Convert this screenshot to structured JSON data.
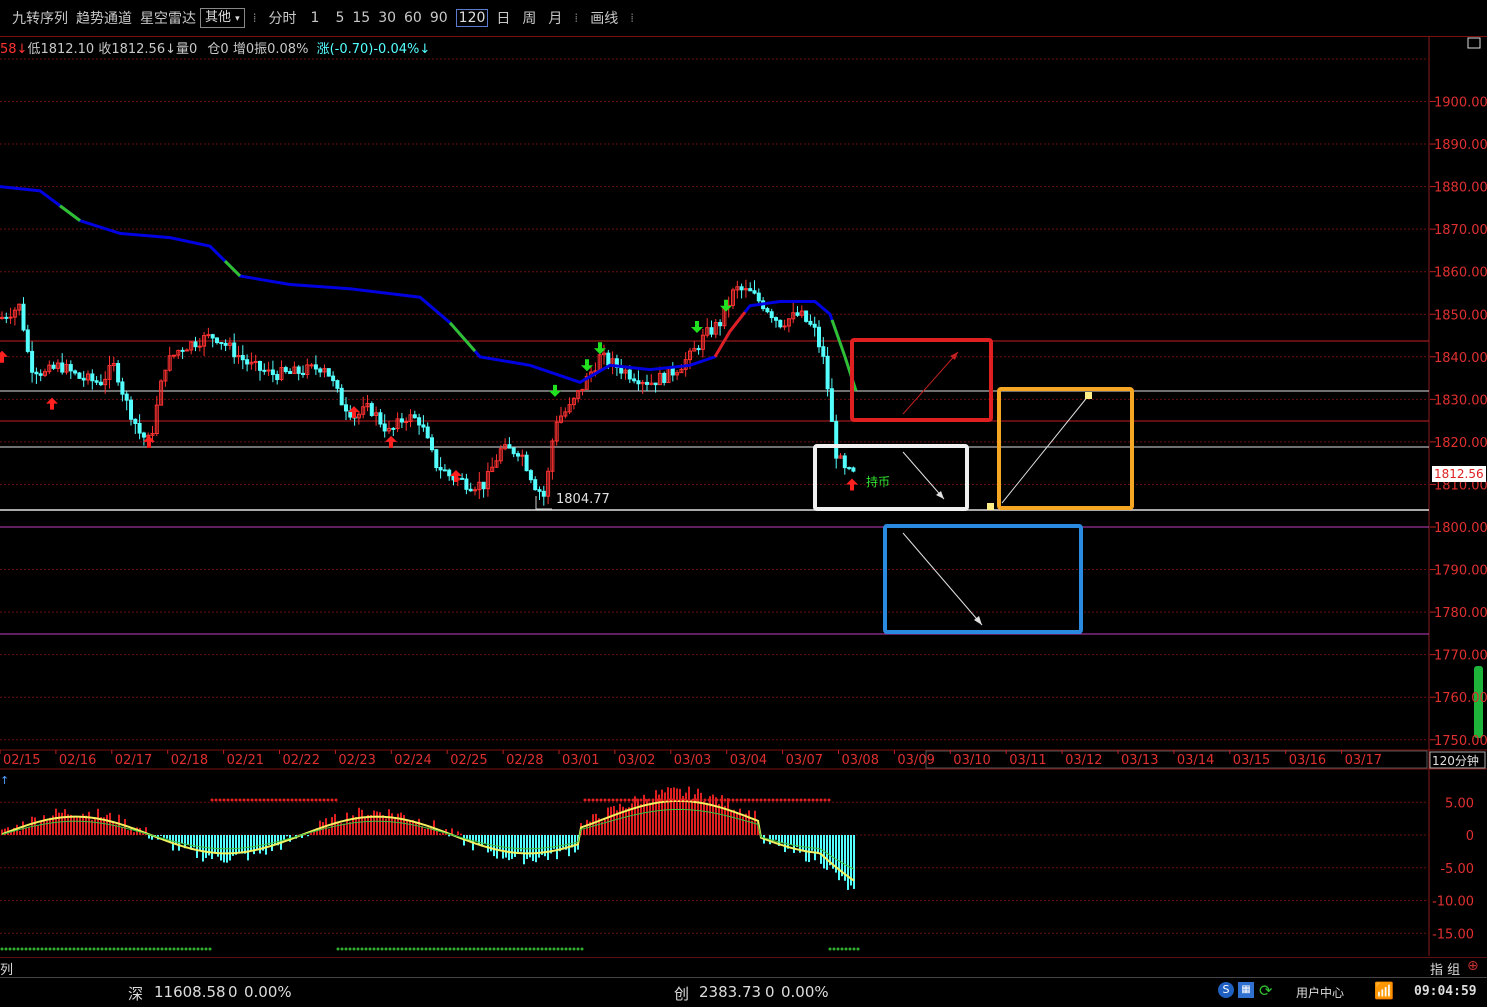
{
  "toolbar": {
    "items": [
      "九转序列",
      "趋势通道",
      "星空雷达"
    ],
    "select_label": "其他",
    "periods": [
      "分时",
      "1",
      "5",
      "15",
      "30",
      "60",
      "90",
      "120",
      "日",
      "周",
      "月"
    ],
    "active_period": "120",
    "draw_label": "画线"
  },
  "info": {
    "prefix": "58↓",
    "low": "低1812.10",
    "close": "收1812.56↓",
    "volume": "量0",
    "position": "仓0",
    "increase": "增0",
    "amplitude": "振0.08%",
    "change": "涨(-0.70)-0.04%↓"
  },
  "price_axis": {
    "labels": [
      "1900.00",
      "1890.00",
      "1880.00",
      "1870.00",
      "1860.00",
      "1850.00",
      "1840.00",
      "1830.00",
      "1820.00",
      "1810.00",
      "1800.00",
      "1790.00",
      "1780.00",
      "1770.00",
      "1760.00",
      "1750.00"
    ],
    "current_price": "1812.56"
  },
  "date_axis": {
    "labels": [
      "02/15",
      "02/16",
      "02/17",
      "02/18",
      "02/21",
      "02/22",
      "02/23",
      "02/24",
      "02/25",
      "02/28",
      "03/01",
      "03/02",
      "03/03",
      "03/04",
      "03/07",
      "03/08",
      "03/09",
      "03/10",
      "03/11",
      "03/12",
      "03/13",
      "03/14",
      "03/15",
      "03/16",
      "03/17"
    ],
    "period_label": "120分钟"
  },
  "annotations": {
    "low_label": "1804.77",
    "hold_label": "持币"
  },
  "indicator_axis": {
    "labels": [
      "5.00",
      "0",
      "-5.00",
      "-10.00",
      "-15.00"
    ]
  },
  "bottom_tabs": {
    "left": "列",
    "right": "指 组"
  },
  "status_bar": {
    "shen": "深",
    "shen_value": "11608.58",
    "shen_change": "0",
    "shen_pct": "0.00%",
    "chuang": "创",
    "chuang_value": "2383.73",
    "chuang_change": "0",
    "chuang_pct": "0.00%",
    "user_center": "用户中心",
    "time": "09:04:59"
  },
  "colors": {
    "up": "#ff3232",
    "down": "#54ffff",
    "trend": "#0000e0",
    "accent_red": "#e02020",
    "accent_orange": "#f5a623",
    "accent_blue": "#2a8ae0"
  }
}
